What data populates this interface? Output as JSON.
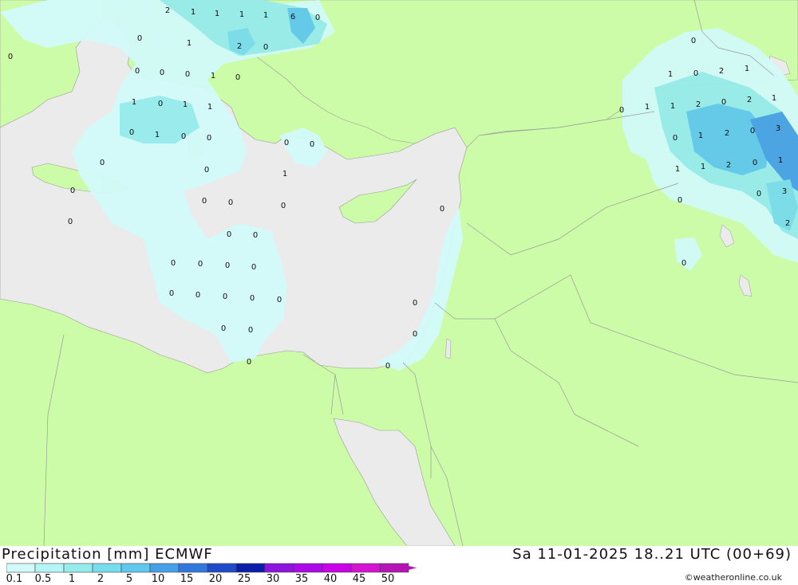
{
  "header": {
    "product_label": "Precipitation [mm]",
    "model_label": "ECMWF",
    "valid_time": "Sa 11-01-2025 18..21 UTC (00+69)"
  },
  "credit": "©weatheronline.co.uk",
  "legend": {
    "labels": [
      "0.1",
      "0.5",
      "1",
      "2",
      "5",
      "10",
      "15",
      "20",
      "25",
      "30",
      "35",
      "40",
      "45",
      "50"
    ],
    "colors": [
      "#d2fafa",
      "#b4f5f5",
      "#96ebeb",
      "#78dcec",
      "#5fc8ec",
      "#46a0e6",
      "#3278dc",
      "#1e4bc8",
      "#0a1eaa",
      "#8c14dc",
      "#aa0ae6",
      "#c800e6",
      "#d214d2",
      "#b414b4"
    ]
  },
  "colors": {
    "land": "#ccfca8",
    "sea_dry": "#ebebeb",
    "borders": "#9a9a9a"
  },
  "precip_values": [
    "2",
    "1",
    "1",
    "1",
    "1",
    "6",
    "0",
    "0",
    "1",
    "2",
    "0",
    "0",
    "0",
    "0",
    "0",
    "1",
    "0",
    "1",
    "0",
    "1",
    "1",
    "0",
    "1",
    "0",
    "0",
    "0",
    "0",
    "0",
    "0",
    "1",
    "0",
    "0",
    "0",
    "0",
    "0",
    "0",
    "0",
    "0",
    "0",
    "0",
    "0",
    "0",
    "0",
    "0",
    "0",
    "0",
    "0",
    "0",
    "0",
    "0",
    "0",
    "0",
    "0",
    "0",
    "1",
    "0",
    "2",
    "1",
    "0",
    "1",
    "1",
    "2",
    "0",
    "2",
    "1",
    "0",
    "1",
    "2",
    "0",
    "3",
    "1",
    "1",
    "2",
    "0",
    "1",
    "0",
    "0",
    "3",
    "2",
    "0"
  ]
}
